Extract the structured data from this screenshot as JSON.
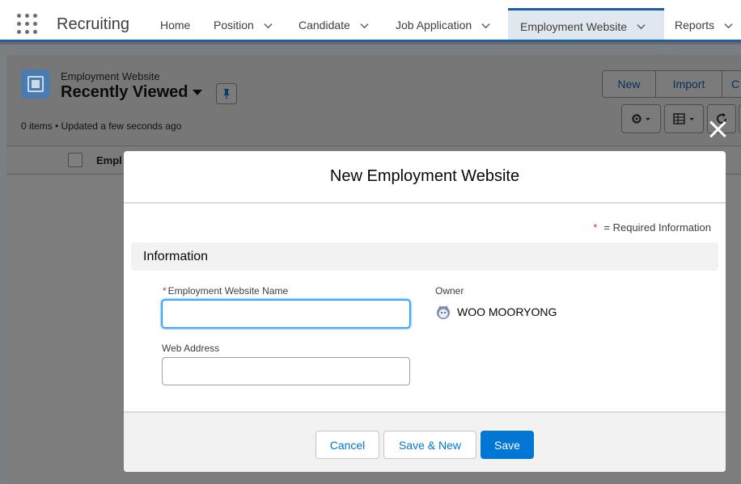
{
  "app": {
    "name": "Recruiting"
  },
  "nav": {
    "items": [
      {
        "label": "Home",
        "has_menu": false
      },
      {
        "label": "Position",
        "has_menu": true
      },
      {
        "label": "Candidate",
        "has_menu": true
      },
      {
        "label": "Job Application",
        "has_menu": true
      },
      {
        "label": "Employment Website",
        "has_menu": true,
        "active": true
      },
      {
        "label": "Reports",
        "has_menu": true
      }
    ]
  },
  "list_view": {
    "object_label": "Employment Website",
    "title": "Recently Viewed",
    "meta": "0 items • Updated a few seconds ago",
    "buttons": {
      "new": "New",
      "import": "Import",
      "overflow": "C"
    },
    "column_header": "Empl",
    "icons": [
      "settings-gear-icon",
      "table-view-icon",
      "refresh-icon",
      "pin-icon"
    ]
  },
  "modal": {
    "title": "New Employment Website",
    "required_note": "= Required Information",
    "required_marker": "*",
    "section_title": "Information",
    "fields": {
      "name": {
        "label": "Employment Website Name",
        "value": ""
      },
      "web_address": {
        "label": "Web Address",
        "value": ""
      },
      "owner": {
        "label": "Owner",
        "value": "WOO MOORYONG"
      }
    },
    "footer": {
      "cancel": "Cancel",
      "save_new": "Save & New",
      "save": "Save"
    }
  },
  "colors": {
    "brand": "#0176d3",
    "nav_accent": "#1b5f9e",
    "required": "#c23934",
    "focus": "#1b96ff"
  }
}
